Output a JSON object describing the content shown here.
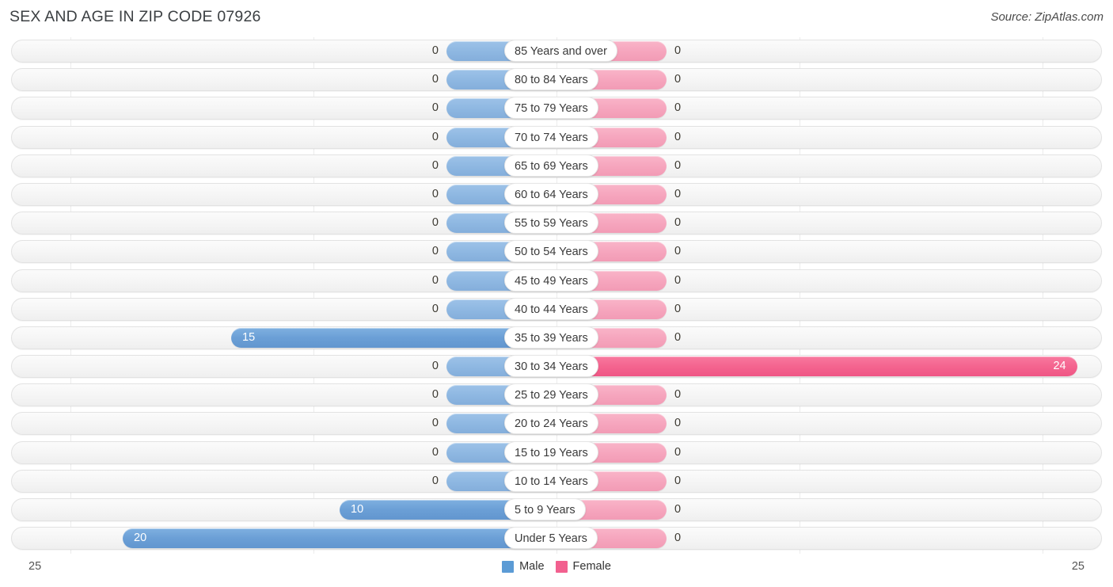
{
  "header": {
    "title": "SEX AND AGE IN ZIP CODE 07926",
    "source": "Source: ZipAtlas.com"
  },
  "legend": {
    "male_label": "Male",
    "female_label": "Female",
    "male_color": "#5b9bd5",
    "female_color": "#f2608f"
  },
  "axis": {
    "left_tick": "25",
    "right_tick": "25"
  },
  "chart_data": {
    "type": "bar",
    "title": "SEX AND AGE IN ZIP CODE 07926",
    "subtitle": "Source: ZipAtlas.com",
    "xlabel": "",
    "ylabel": "",
    "orientation": "horizontal",
    "layout": "population-pyramid",
    "grid": true,
    "legend_position": "bottom-center",
    "xlim": [
      25,
      25
    ],
    "axis_max": 25,
    "categories": [
      "85 Years and over",
      "80 to 84 Years",
      "75 to 79 Years",
      "70 to 74 Years",
      "65 to 69 Years",
      "60 to 64 Years",
      "55 to 59 Years",
      "50 to 54 Years",
      "45 to 49 Years",
      "40 to 44 Years",
      "35 to 39 Years",
      "30 to 34 Years",
      "25 to 29 Years",
      "20 to 24 Years",
      "15 to 19 Years",
      "10 to 14 Years",
      "5 to 9 Years",
      "Under 5 Years"
    ],
    "series": [
      {
        "name": "Male",
        "color": "#5b9bd5",
        "values": [
          0,
          0,
          0,
          0,
          0,
          0,
          0,
          0,
          0,
          0,
          15,
          0,
          0,
          0,
          0,
          0,
          10,
          20
        ]
      },
      {
        "name": "Female",
        "color": "#f2608f",
        "values": [
          0,
          0,
          0,
          0,
          0,
          0,
          0,
          0,
          0,
          0,
          0,
          24,
          0,
          0,
          0,
          0,
          0,
          0
        ]
      }
    ]
  }
}
